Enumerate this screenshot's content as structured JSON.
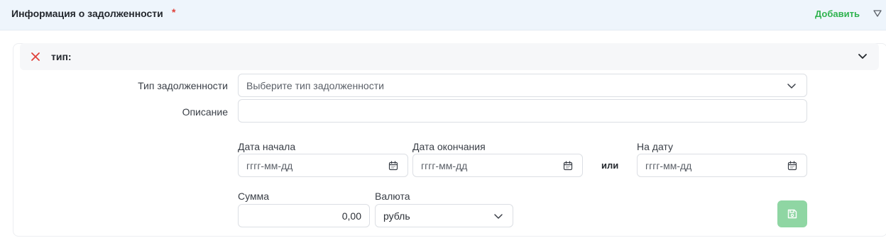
{
  "section": {
    "title": "Информация о задолженности",
    "required_mark": "*",
    "add_label": "Добавить"
  },
  "card": {
    "title": "тип:"
  },
  "form": {
    "debt_type": {
      "label": "Тип задолженности",
      "placeholder": "Выберите тип задолженности"
    },
    "description": {
      "label": "Описание",
      "value": ""
    },
    "start_date": {
      "label": "Дата начала",
      "placeholder": "гггг-мм-дд"
    },
    "end_date": {
      "label": "Дата окончания",
      "placeholder": "гггг-мм-дд"
    },
    "or_label": "или",
    "on_date": {
      "label": "На дату",
      "placeholder": "гггг-мм-дд"
    },
    "amount": {
      "label": "Сумма",
      "value": "0,00"
    },
    "currency": {
      "label": "Валюта",
      "value": "рубль"
    }
  },
  "colors": {
    "accent_green": "#2fb34f",
    "save_button": "#8fd6a3",
    "required_red": "#e0413a",
    "header_bg": "#eef5fc"
  },
  "icons": {
    "remove": "close-icon",
    "expand": "chevron-down-icon",
    "collapse_section": "triangle-down-icon",
    "date": "calendar-icon",
    "save": "save-icon"
  }
}
